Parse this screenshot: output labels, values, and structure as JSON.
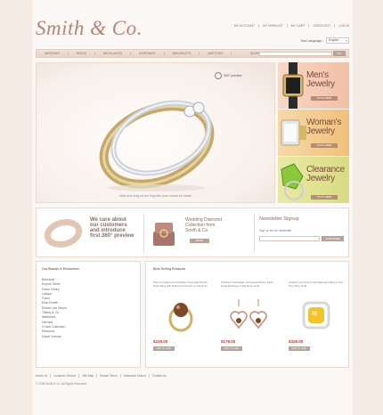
{
  "brand": {
    "logo_text": "Smith & Co."
  },
  "top_links": [
    "MY ACCOUNT",
    "MY WISHLIST",
    "MY CART",
    "CHECKOUT",
    "LOG IN"
  ],
  "language": {
    "label": "Your Language :",
    "selected": "English"
  },
  "nav": {
    "items": [
      "WEDDING",
      "RINGS",
      "NECKLACES",
      "EARRINGS",
      "BRACELETS",
      "WATCHES"
    ],
    "search_label": "SEARCH",
    "search_placeholder": "",
    "go_label": "GO"
  },
  "hero": {
    "badge_text": "360° preview",
    "caption": "Click and drag on the ring with your mouse for rotate"
  },
  "promos": [
    {
      "title_line1": "Men's",
      "title_line2": "Jewelry",
      "button": "CLICK HERE"
    },
    {
      "title_line1": "Woman's",
      "title_line2": "Jewelry",
      "button": "CLICK HERE"
    },
    {
      "title_line1": "Clearance",
      "title_line2": "Jewelry",
      "button": "CLICK HERE"
    }
  ],
  "features": {
    "care_line1": "We care about",
    "care_line2": "our customers",
    "care_line3": "and introduce",
    "care_line4": "first 360° preview",
    "wedding_line1": "Wedding Diamond",
    "wedding_line2": "Collection from",
    "wedding_line3": "Smith & Co.",
    "wedding_button": "MORE",
    "newsletter_title": "Newsletter Signup",
    "newsletter_sub": "Sign up for our newsletter",
    "newsletter_button": "SUBSCRIBE"
  },
  "brands": {
    "title": "Our Brands & Exclusives",
    "items": [
      "Baccarat",
      "Empire Silver",
      "Frank Gehry",
      "Lalique",
      "Gucci",
      "Elsa Peretti",
      "Robert Lee Morris",
      "Tiffany & Co",
      "Waterford",
      "Hermes",
      "Crown Collection",
      "Rebecca",
      "David Yurman"
    ]
  },
  "best": {
    "title": "Best Selling Products",
    "products": [
      {
        "desc": "8-9mm Cultured Freshwater Chocolate Brown Pearl Ring with Diamond Accents in 14k Gold",
        "price": "$229.00",
        "cart": "ADD TO CART"
      },
      {
        "desc": "Cultured Freshwater Chocolate Brown Pearl Heart Earrings in 14k Rose Gold",
        "price": "$179.00",
        "cart": "ADD TO CART"
      },
      {
        "desc": "Cushion-Cut Citrine and Diamond Ring in 14k Two-Tone Gold",
        "price": "$329.00",
        "cart": "ADD TO CART"
      }
    ]
  },
  "footer": {
    "links": [
      "About Us",
      "Customer Service",
      "Site Map",
      "Search Terms",
      "Advanced Search",
      "Contact Us"
    ],
    "copyright": "© 2008 Smith & Co. All Rights Reserved."
  }
}
